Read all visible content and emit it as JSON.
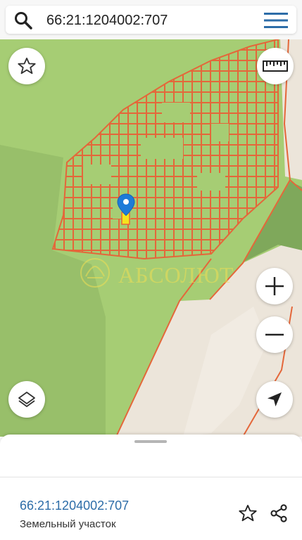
{
  "search": {
    "query": "66:21:1204002:707"
  },
  "map": {
    "watermark_text": "АБСОЛЮТ",
    "colors": {
      "field": "#a6cd74",
      "plot_border": "#e4673a",
      "road": "#ece5da",
      "marker": "#1e7bd8",
      "selected_plot": "#f5e41d"
    },
    "controls": [
      "favorite-star",
      "ruler",
      "zoom-in",
      "zoom-out",
      "layers",
      "locate"
    ]
  },
  "parcel": {
    "cadastral_number": "66:21:1204002:707",
    "type": "Земельный участок"
  }
}
